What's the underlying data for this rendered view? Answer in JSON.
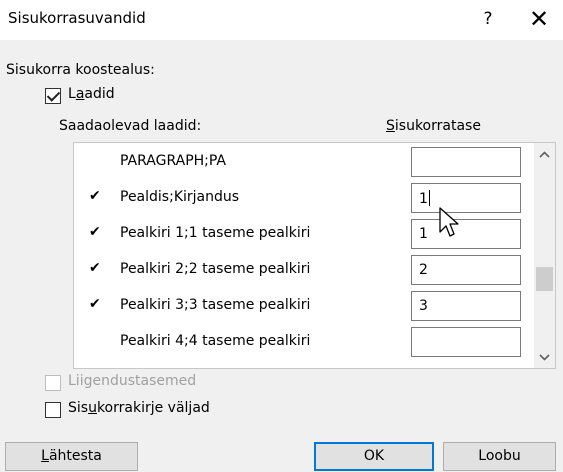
{
  "window": {
    "title": "Sisukorrasuvandid",
    "help_label": "?",
    "close_label": "✕"
  },
  "build_from_label": "Sisukorra koostealus:",
  "styles_checkbox": {
    "label_pre": "L",
    "label_accel": "a",
    "label_post": "adid",
    "checked": true
  },
  "available_styles_header": "Saadaolevad laadid:",
  "toc_level_header": {
    "accel": "S",
    "rest": "isukorratase"
  },
  "style_rows": [
    {
      "checked": false,
      "name": "PARAGRAPH;PA",
      "level": ""
    },
    {
      "checked": true,
      "name": "Pealdis;Kirjandus",
      "level": "1"
    },
    {
      "checked": true,
      "name": "Pealkiri 1;1 taseme pealkiri",
      "level": "1"
    },
    {
      "checked": true,
      "name": "Pealkiri 2;2 taseme pealkiri",
      "level": "2"
    },
    {
      "checked": true,
      "name": "Pealkiri 3;3 taseme pealkiri",
      "level": "3"
    },
    {
      "checked": false,
      "name": "Pealkiri 4;4 taseme pealkiri",
      "level": ""
    }
  ],
  "check_mark": "✔",
  "outline_levels_checkbox": {
    "label": "Liigendustasemed",
    "checked": false,
    "enabled": false
  },
  "entry_fields_checkbox": {
    "label_pre": "Sis",
    "label_accel": "u",
    "label_post": "korrakirje väljad",
    "checked": false
  },
  "buttons": {
    "reset": {
      "accel": "L",
      "rest": "ähtesta"
    },
    "ok": "OK",
    "cancel": "Loobu"
  },
  "scrollbar": {
    "up_icon": "chevron-up",
    "down_icon": "chevron-down"
  }
}
